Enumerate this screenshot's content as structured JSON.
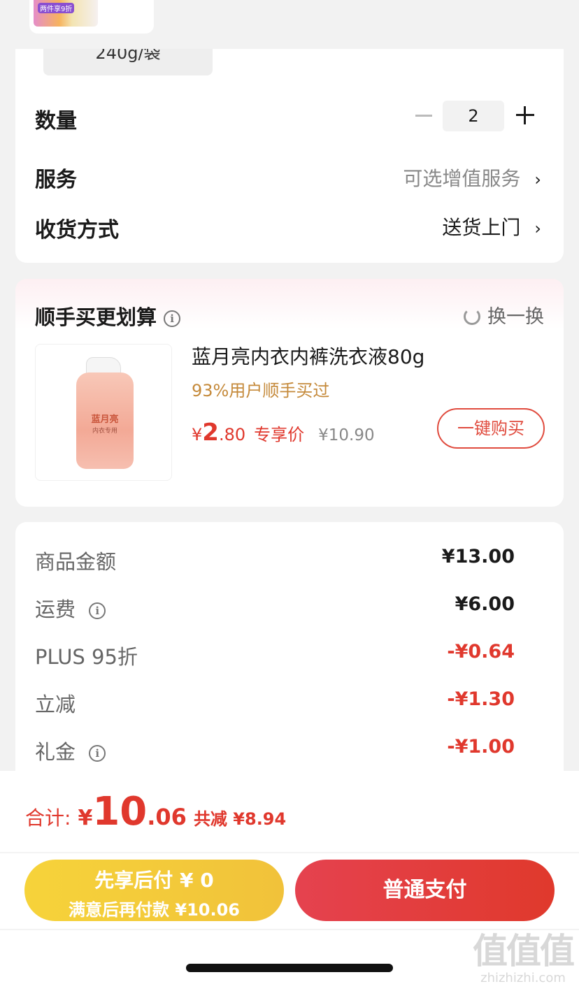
{
  "top": {
    "thumb_tag": "两件享9折"
  },
  "product": {
    "spec": "240g/袋",
    "quantity_label": "数量",
    "quantity": "2",
    "service_label": "服务",
    "service_value": "可选增值服务",
    "delivery_label": "收货方式",
    "delivery_value": "送货上门",
    "chevron": "›"
  },
  "addon": {
    "title": "顺手买更划算",
    "refresh_label": "换一换",
    "product_name": "蓝月亮内衣内裤洗衣液80g",
    "sub_text": "93%用户顺手买过",
    "price_symbol": "¥",
    "price_int": "2",
    "price_dec": ".80",
    "price_tag": "专享价",
    "orig_price": "¥10.90",
    "buy_button": "一键购买",
    "bottle_brand": "蓝月亮",
    "bottle_desc": "内衣专用"
  },
  "fees": [
    {
      "label": "商品金额",
      "value": "¥13.00",
      "info": false,
      "red": false
    },
    {
      "label": "运费",
      "value": "¥6.00",
      "info": true,
      "red": false
    },
    {
      "label": "PLUS 95折",
      "value": "-¥0.64",
      "info": false,
      "red": true
    },
    {
      "label": "立减",
      "value": "-¥1.30",
      "info": false,
      "red": true
    },
    {
      "label": "礼金",
      "value": "-¥1.00",
      "info": true,
      "red": true
    }
  ],
  "footer": {
    "total_label": "合计:",
    "total_symbol": "¥",
    "total_int": "10",
    "total_dec": ".06",
    "total_save": "共减 ¥8.94",
    "later_line1": "先享后付 ¥ 0",
    "later_line2": "满意后再付款 ¥10.06",
    "pay_button": "普通支付"
  },
  "watermark": {
    "main": "值值值",
    "domain": "zhizhizhi.com"
  }
}
